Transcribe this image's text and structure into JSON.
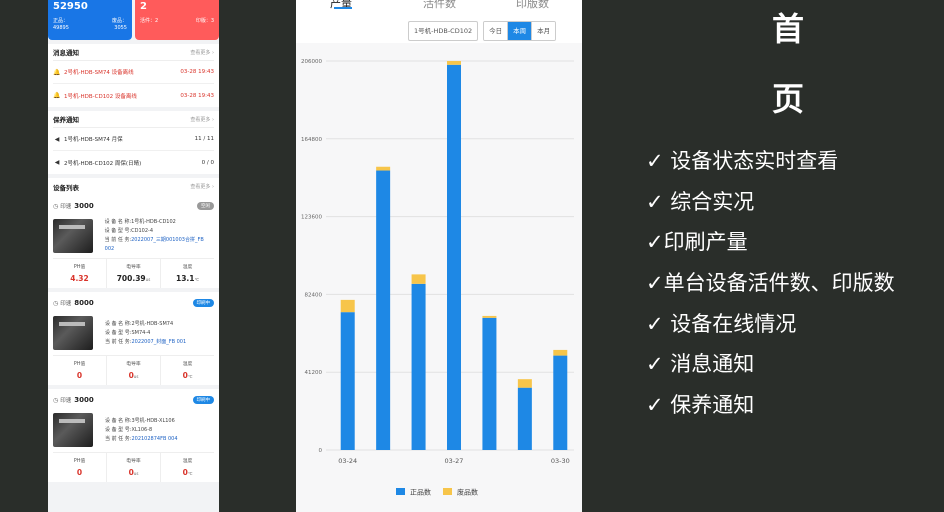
{
  "phone": {
    "stats": {
      "left": {
        "value": "52950",
        "label_a": "正品：",
        "label_b": "废品：",
        "value_a": "49895",
        "value_b": "3055"
      },
      "right": {
        "value": "2",
        "label_a": "活件：2",
        "label_b": "印版：3"
      }
    },
    "messages": {
      "title": "消息通知",
      "more": "查看更多",
      "items": [
        {
          "text": "2号机-HDB-SM74 设备离线",
          "time": "03-28 19:43"
        },
        {
          "text": "1号机-HDB-CD102 设备离线",
          "time": "03-28 19:43"
        }
      ]
    },
    "maintenance": {
      "title": "保养通知",
      "more": "查看更多",
      "items": [
        {
          "text": "1号机-HDB-SM74 月保",
          "value": "11 / 11"
        },
        {
          "text": "2号机-HDB-CD102 周保(日睛)",
          "value": "0 / 0"
        }
      ]
    },
    "devices": {
      "title": "设备列表",
      "more": "查看更多",
      "metric_labels": {
        "ph": "PH值",
        "cond": "电导率",
        "temp": "温度"
      },
      "units": {
        "cond": "us",
        "temp": "℃"
      },
      "info_labels": {
        "name": "设 备 名 称:",
        "model": "设 备 型 号:",
        "task": "当 前 任 务:"
      },
      "speed_label": "印速",
      "items": [
        {
          "speed": "3000",
          "status": "空闲",
          "status_type": "idle",
          "name": "1号机-HDB-CD102",
          "model": "CD102-4",
          "task": "2022007_三期001003合拼_FB 002",
          "ph": "4.32",
          "cond": "700.39",
          "temp": "13.1"
        },
        {
          "speed": "8000",
          "status": "印刷中",
          "status_type": "run",
          "name": "2号机-HDB-SM74",
          "model": "SM74-4",
          "task": "2022007_封面_FB 001",
          "ph": "0",
          "cond": "0",
          "temp": "0"
        },
        {
          "speed": "3000",
          "status": "印刷中",
          "status_type": "run",
          "name": "3号机-HDB-XL106",
          "model": "XL106-8",
          "task": "202102874FB 004",
          "ph": "0",
          "cond": "0",
          "temp": "0"
        }
      ]
    }
  },
  "chart_panel": {
    "tabs": [
      "产量",
      "活件数",
      "印版数"
    ],
    "active_tab": 0,
    "device_select": "1号机-HDB-CD102",
    "periods": [
      "今日",
      "本周",
      "本月"
    ],
    "active_period": 1
  },
  "chart_data": {
    "type": "bar",
    "stacked": true,
    "categories": [
      "03-24",
      "03-25",
      "03-26",
      "03-27",
      "03-28",
      "03-29",
      "03-30"
    ],
    "x_tick_labels": [
      "03-24",
      "03-27",
      "03-30"
    ],
    "series": [
      {
        "name": "正品数",
        "color": "#1e88e5",
        "values": [
          73000,
          148000,
          88000,
          204000,
          70000,
          33000,
          50000
        ]
      },
      {
        "name": "废品数",
        "color": "#f7c54a",
        "values": [
          6500,
          2000,
          5000,
          2000,
          1000,
          4500,
          3000
        ]
      }
    ],
    "ylim": [
      0,
      206000
    ],
    "y_ticks": [
      0,
      41200,
      82400,
      123600,
      164800,
      206000
    ],
    "grid": true,
    "legend_position": "bottom"
  },
  "features": {
    "title_chars": [
      "首",
      "页"
    ],
    "items": [
      "✓ 设备状态实时查看",
      "✓ 综合实况",
      "✓印刷产量",
      "✓单台设备活件数、印版数",
      "✓ 设备在线情况",
      "✓ 消息通知",
      "✓ 保养通知"
    ]
  }
}
